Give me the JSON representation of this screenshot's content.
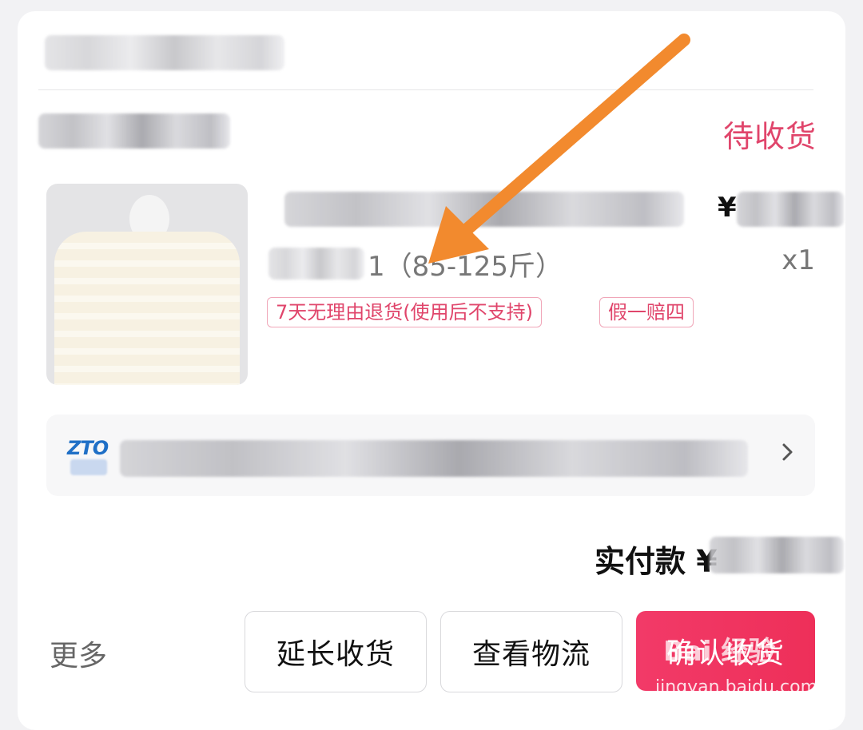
{
  "order": {
    "status": "待收货",
    "product": {
      "price_symbol": "¥",
      "spec_suffix": "1（85-125斤）",
      "quantity": "x1",
      "tags": [
        "7天无理由退货(使用后不支持)",
        "假一赔四"
      ]
    },
    "logistics": {
      "carrier_logo": "ZTO",
      "chevron_icon": "chevron-right-icon"
    },
    "total_label": "实付款 ¥"
  },
  "actions": {
    "more": "更多",
    "extend": "延长收货",
    "track": "查看物流",
    "confirm": "确认收货"
  },
  "watermark": {
    "brand": "Bai 经验",
    "url": "jingyan.baidu.com"
  },
  "colors": {
    "accent": "#e0456b",
    "primary_button": "#f23a68",
    "arrow": "#f28a2e"
  }
}
